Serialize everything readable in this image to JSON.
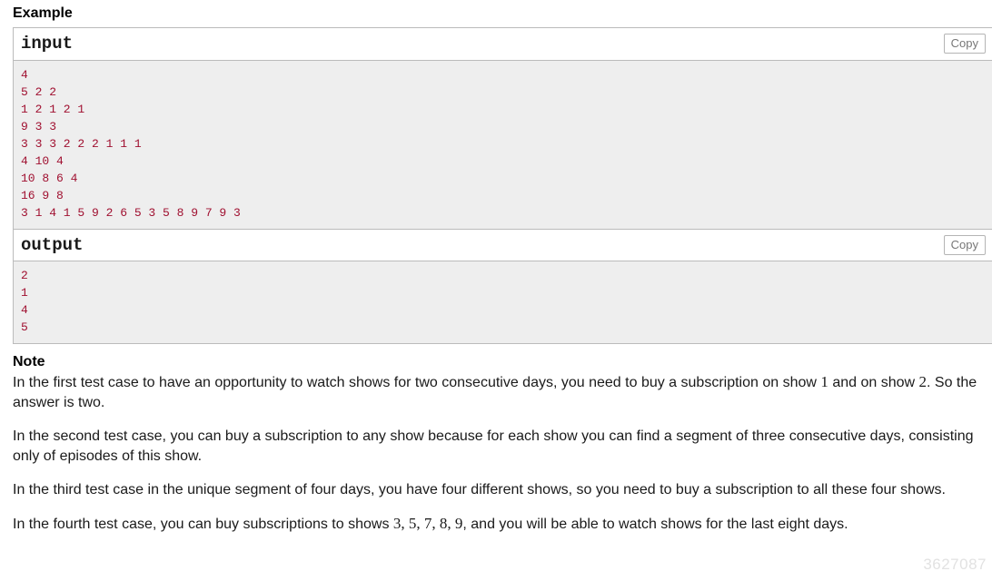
{
  "example": {
    "heading": "Example",
    "input": {
      "label": "input",
      "copy_label": "Copy",
      "text": "4\n5 2 2\n1 2 1 2 1\n9 3 3\n3 3 3 2 2 2 1 1 1\n4 10 4\n10 8 6 4\n16 9 8\n3 1 4 1 5 9 2 6 5 3 5 8 9 7 9 3"
    },
    "output": {
      "label": "output",
      "copy_label": "Copy",
      "text": "2\n1\n4\n5"
    }
  },
  "note": {
    "heading": "Note",
    "paragraphs": [
      {
        "parts": [
          {
            "type": "text",
            "value": "In the first test case to have an opportunity to watch shows for two consecutive days, you need to buy a subscription on show "
          },
          {
            "type": "math",
            "value": "1"
          },
          {
            "type": "text",
            "value": " and on show "
          },
          {
            "type": "math",
            "value": "2"
          },
          {
            "type": "text",
            "value": ". So the answer is two."
          }
        ]
      },
      {
        "parts": [
          {
            "type": "text",
            "value": "In the second test case, you can buy a subscription to any show because for each show you can find a segment of three consecutive days, consisting only of episodes of this show."
          }
        ]
      },
      {
        "parts": [
          {
            "type": "text",
            "value": "In the third test case in the unique segment of four days, you have four different shows, so you need to buy a subscription to all these four shows."
          }
        ]
      },
      {
        "parts": [
          {
            "type": "text",
            "value": "In the fourth test case, you can buy subscriptions to shows "
          },
          {
            "type": "math",
            "value": "3, 5, 7, 8, 9"
          },
          {
            "type": "text",
            "value": ", and you will be able to watch shows for the last eight days."
          }
        ]
      }
    ]
  },
  "watermark": {
    "text": "3627087"
  },
  "colors": {
    "data_text": "#a01030",
    "data_bg": "#eeeeee",
    "border": "#bbbbbb",
    "copy_text": "#777777"
  }
}
